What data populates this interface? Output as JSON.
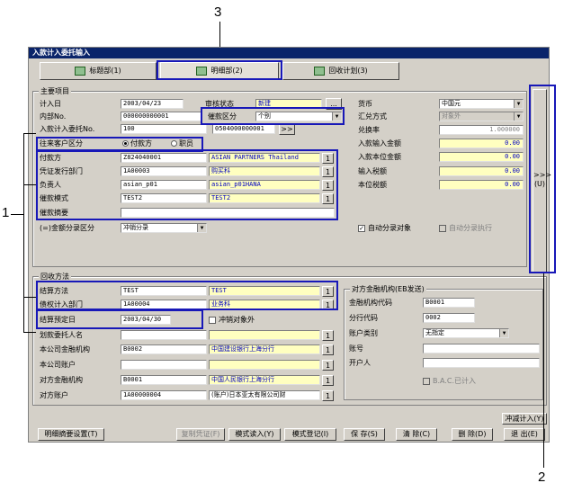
{
  "window_title": "入款计入委托输入",
  "tabs": [
    {
      "label": "标题部(1)"
    },
    {
      "label": "明细部(2)"
    },
    {
      "label": "回收计划(3)"
    }
  ],
  "callouts": {
    "c1": "1",
    "c2": "2",
    "c3": "3"
  },
  "main": {
    "title": "主要项目",
    "record_date_label": "计入日",
    "record_date": "2003/04/23",
    "audit_label": "审核状态",
    "audit_value": "新建",
    "dots": "...",
    "internal_no_label": "内部No.",
    "internal_no": "000000000001",
    "collect_type_label": "催款区分",
    "collect_type": "个别",
    "entry_no_label": "入款计入委托No.",
    "entry_no": "100",
    "entry_no2": "0504000000001",
    "entry_btn": ">>",
    "partner_type_label": "往来客户区分",
    "radio_payer": "付款方",
    "radio_staff": "职员",
    "payer_label": "付款方",
    "payer_code": "Z824040001",
    "payer_name": "ASIAN PARTNERS Thailand",
    "voucher_dept_label": "凭证发行部门",
    "voucher_dept_code": "1A00003",
    "voucher_dept_name": "购买科",
    "person_label": "负责人",
    "person_code": "asian_p01",
    "person_name": "asian_p01HANA",
    "collect_mode_label": "催款模式",
    "collect_mode_code": "TEST2",
    "collect_mode_name": "TEST2",
    "summary_label": "催款摘要",
    "split_label": "(=)金额分录区分",
    "split_value": "冲销分录",
    "small_btn": "1",
    "currency_label": "货币",
    "currency": "中国元",
    "fx_label": "汇兑方式",
    "fx_value": "对象外",
    "rate_label": "兑换率",
    "rate": "1.000000",
    "in_amt_label": "入款输入金额",
    "in_amt": "0.00",
    "in_local_label": "入款本位金额",
    "in_local": "0.00",
    "tax_in_label": "输入税额",
    "tax_in": "0.00",
    "tax_local_label": "本位税额",
    "tax_local": "0.00",
    "auto_target": "自动分录对象",
    "auto_exec": "自动分录执行",
    "side_btn": ">>>",
    "side_btn_sub": "(U)"
  },
  "recovery": {
    "title": "回收方法",
    "settle_label": "结算方法",
    "settle_code": "TEST",
    "settle_name": "TEST",
    "dept_label": "债权计入部门",
    "dept_code": "1A00004",
    "dept_name": "业务科",
    "due_label": "结算预定日",
    "due_date": "2003/04/30",
    "offset_chk": "冲销对象外",
    "consign_label": "划款委托人名",
    "bank_label": "本公司金融机构",
    "bank_code": "B0002",
    "bank_name": "中国建设银行上海分行",
    "account_label": "本公司账户",
    "peer_bank_label": "对方金融机构",
    "peer_bank_code": "B0001",
    "peer_bank_name": "中国人民银行上海分行",
    "peer_acct_label": "对方账户",
    "peer_acct_code": "1A00000004",
    "peer_acct_name": "(账户)日本亚太有限公司财"
  },
  "eb": {
    "title": "对方金融机构(EB发送)",
    "inst_code_label": "金融机构代码",
    "inst_code": "B0001",
    "branch_label": "分行代码",
    "branch": "0002",
    "acct_type_label": "账户类别",
    "acct_type": "无指定",
    "acct_no_label": "账号",
    "holder_label": "开户人",
    "bac_label": "B.A.C.已计入"
  },
  "buttons": {
    "offset_entry": "冲减计入(Y)",
    "detail_summary": "明细摘要设置(T)",
    "copy_voucher": "复制凭证(F)",
    "mode_read": "模式读入(Y)",
    "mode_register": "模式登记(I)",
    "save": "保 存(S)",
    "clear": "清 除(C)",
    "delete": "删 除(D)",
    "exit": "退 出(E)"
  }
}
